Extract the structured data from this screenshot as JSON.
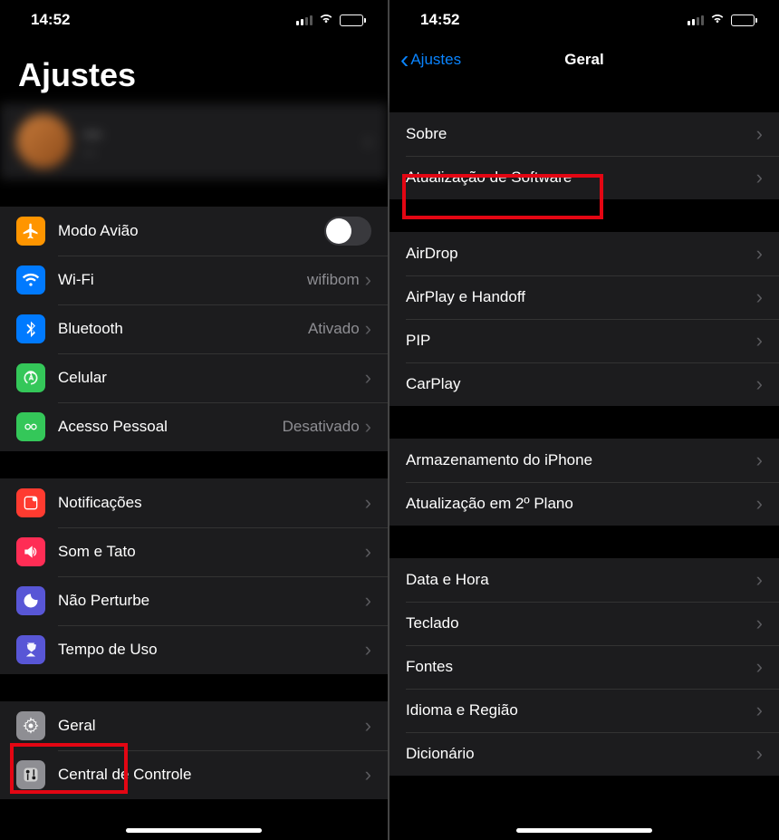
{
  "status": {
    "time": "14:52"
  },
  "left": {
    "title": "Ajustes",
    "profile": {
      "name": "—",
      "sub": "—"
    },
    "group1": [
      {
        "name": "airplane-mode",
        "icon": "airplane",
        "label": "Modo Avião",
        "toggle": true
      },
      {
        "name": "wifi",
        "icon": "wifi",
        "label": "Wi-Fi",
        "value": "wifibom"
      },
      {
        "name": "bluetooth",
        "icon": "bluetooth",
        "label": "Bluetooth",
        "value": "Ativado"
      },
      {
        "name": "cellular",
        "icon": "cellular",
        "label": "Celular"
      },
      {
        "name": "hotspot",
        "icon": "hotspot",
        "label": "Acesso Pessoal",
        "value": "Desativado"
      }
    ],
    "group2": [
      {
        "name": "notifications",
        "icon": "notif",
        "label": "Notificações"
      },
      {
        "name": "sound",
        "icon": "sound",
        "label": "Som e Tato"
      },
      {
        "name": "dnd",
        "icon": "dnd",
        "label": "Não Perturbe"
      },
      {
        "name": "screentime",
        "icon": "screentime",
        "label": "Tempo de Uso"
      }
    ],
    "group3": [
      {
        "name": "general",
        "icon": "general",
        "label": "Geral"
      },
      {
        "name": "control-center",
        "icon": "control",
        "label": "Central de Controle"
      }
    ]
  },
  "right": {
    "back": "Ajustes",
    "title": "Geral",
    "group1": [
      {
        "name": "about",
        "label": "Sobre"
      },
      {
        "name": "software-update",
        "label": "Atualização de Software"
      }
    ],
    "group2": [
      {
        "name": "airdrop",
        "label": "AirDrop"
      },
      {
        "name": "airplay",
        "label": "AirPlay e Handoff"
      },
      {
        "name": "pip",
        "label": "PIP"
      },
      {
        "name": "carplay",
        "label": "CarPlay"
      }
    ],
    "group3": [
      {
        "name": "storage",
        "label": "Armazenamento do iPhone"
      },
      {
        "name": "background-refresh",
        "label": "Atualização em 2º Plano"
      }
    ],
    "group4": [
      {
        "name": "datetime",
        "label": "Data e Hora"
      },
      {
        "name": "keyboard",
        "label": "Teclado"
      },
      {
        "name": "fonts",
        "label": "Fontes"
      },
      {
        "name": "language",
        "label": "Idioma e Região"
      },
      {
        "name": "dictionary",
        "label": "Dicionário"
      }
    ]
  }
}
